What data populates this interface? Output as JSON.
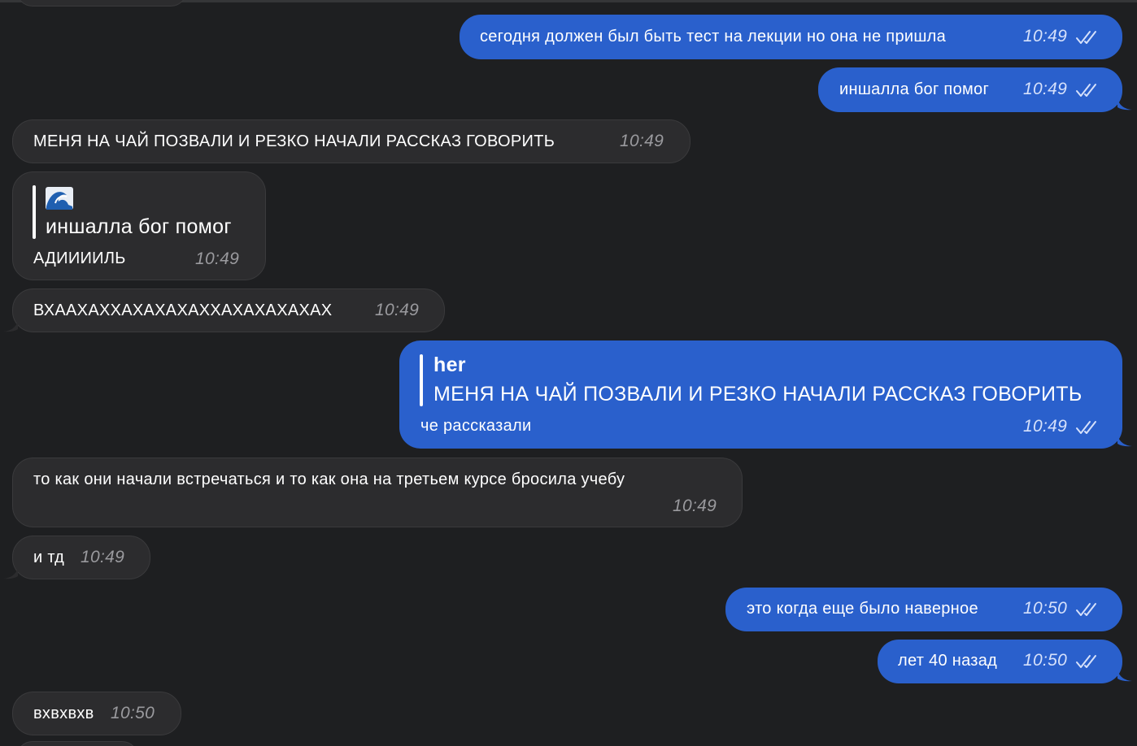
{
  "messages": [
    {
      "text": "сегодня должен был быть тест на лекции но она не пришла",
      "time": "10:49"
    },
    {
      "text": "иншалла бог помог",
      "time": "10:49"
    },
    {
      "text": "МЕНЯ НА ЧАЙ ПОЗВАЛИ И РЕЗКО НАЧАЛИ РАССКАЗ ГОВОРИТЬ",
      "time": "10:49"
    },
    {
      "quote_text": "иншалла бог помог",
      "text": "АДИИИИЛЬ",
      "time": "10:49"
    },
    {
      "text": "ВХААХАХХАХАХАХАХХАХАХАХАХАХ",
      "time": "10:49"
    },
    {
      "quote_name": "her",
      "quote_text": "МЕНЯ НА ЧАЙ ПОЗВАЛИ И РЕЗКО НАЧАЛИ РАССКАЗ ГОВОРИТЬ",
      "text": "че рассказали",
      "time": "10:49"
    },
    {
      "text": "то как они начали встречаться и то как она на третьем курсе бросила учебу",
      "time": "10:49"
    },
    {
      "text": "и тд",
      "time": "10:49"
    },
    {
      "text": "это когда еще было наверное",
      "time": "10:50"
    },
    {
      "text": "лет 40 назад",
      "time": "10:50"
    },
    {
      "text": "вхвхвхв",
      "time": "10:50"
    }
  ],
  "colors": {
    "background": "#1e1f21",
    "incoming_bubble": "#2c2c2e",
    "outgoing_bubble": "#2a60cc"
  },
  "icons": {
    "read_status": "double-check-icon",
    "quote_thumbnail": "wave-emoji-icon"
  }
}
